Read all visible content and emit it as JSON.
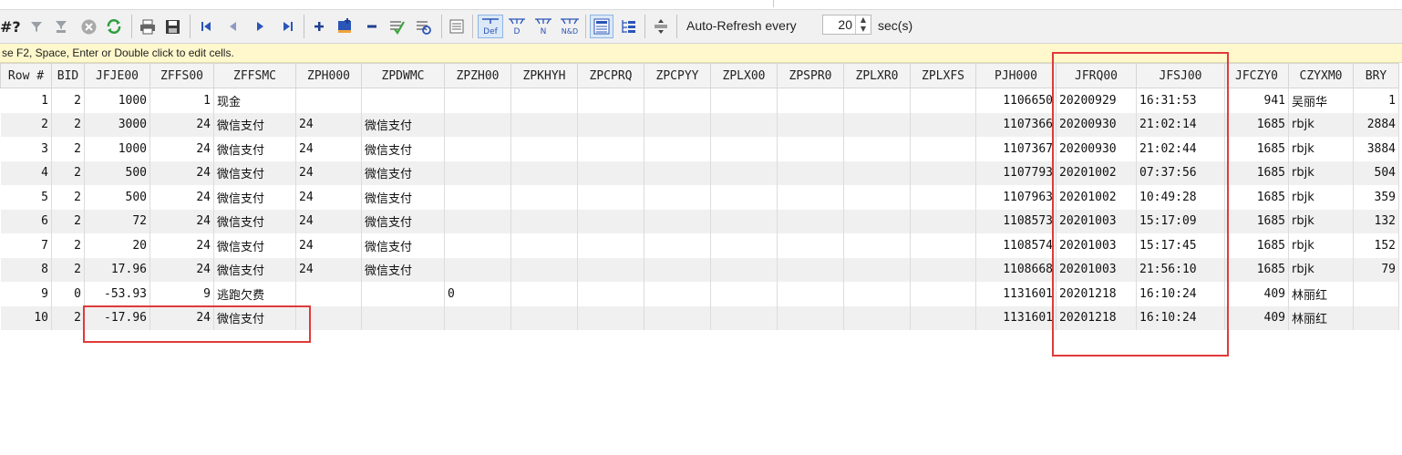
{
  "toolbar": {
    "hash_label": "#?",
    "autorefresh_label": "Auto-Refresh every",
    "interval_value": "20",
    "interval_unit": "sec(s)",
    "def_label": "Def",
    "d_label": "D",
    "n_label": "N",
    "nd_label": "N&D"
  },
  "hint_text": "se F2, Space, Enter or Double click to edit cells.",
  "grid": {
    "columns": [
      "Row #",
      "BID",
      "JFJE00",
      "ZFFS00",
      "ZFFSMC",
      "ZPH000",
      "ZPDWMC",
      "ZPZH00",
      "ZPKHYH",
      "ZPCPRQ",
      "ZPCPYY",
      "ZPLX00",
      "ZPSPR0",
      "ZPLXR0",
      "ZPLXFS",
      "PJH000",
      "JFRQ00",
      "JFSJ00",
      "JFCZY0",
      "CZYXM0",
      "BRY"
    ],
    "rows": [
      [
        "1",
        "2",
        "1000",
        "1",
        "现金",
        "",
        "",
        "",
        "",
        "",
        "",
        "",
        "",
        "",
        "",
        "1106650",
        "20200929",
        "16:31:53",
        "941",
        "吴丽华",
        "1"
      ],
      [
        "2",
        "2",
        "3000",
        "24",
        "微信支付",
        "24",
        "微信支付",
        "",
        "",
        "",
        "",
        "",
        "",
        "",
        "",
        "1107366",
        "20200930",
        "21:02:14",
        "1685",
        "rbjk",
        "2884"
      ],
      [
        "3",
        "2",
        "1000",
        "24",
        "微信支付",
        "24",
        "微信支付",
        "",
        "",
        "",
        "",
        "",
        "",
        "",
        "",
        "1107367",
        "20200930",
        "21:02:44",
        "1685",
        "rbjk",
        "3884"
      ],
      [
        "4",
        "2",
        "500",
        "24",
        "微信支付",
        "24",
        "微信支付",
        "",
        "",
        "",
        "",
        "",
        "",
        "",
        "",
        "1107793",
        "20201002",
        "07:37:56",
        "1685",
        "rbjk",
        "504"
      ],
      [
        "5",
        "2",
        "500",
        "24",
        "微信支付",
        "24",
        "微信支付",
        "",
        "",
        "",
        "",
        "",
        "",
        "",
        "",
        "1107963",
        "20201002",
        "10:49:28",
        "1685",
        "rbjk",
        "359"
      ],
      [
        "6",
        "2",
        "72",
        "24",
        "微信支付",
        "24",
        "微信支付",
        "",
        "",
        "",
        "",
        "",
        "",
        "",
        "",
        "1108573",
        "20201003",
        "15:17:09",
        "1685",
        "rbjk",
        "132"
      ],
      [
        "7",
        "2",
        "20",
        "24",
        "微信支付",
        "24",
        "微信支付",
        "",
        "",
        "",
        "",
        "",
        "",
        "",
        "",
        "1108574",
        "20201003",
        "15:17:45",
        "1685",
        "rbjk",
        "152"
      ],
      [
        "8",
        "2",
        "17.96",
        "24",
        "微信支付",
        "24",
        "微信支付",
        "",
        "",
        "",
        "",
        "",
        "",
        "",
        "",
        "1108668",
        "20201003",
        "21:56:10",
        "1685",
        "rbjk",
        "79"
      ],
      [
        "9",
        "0",
        "-53.93",
        "9",
        "逃跑欠费",
        "",
        "",
        "0",
        "",
        "",
        "",
        "",
        "",
        "",
        "",
        "1131601",
        "20201218",
        "16:10:24",
        "409",
        "林丽红",
        ""
      ],
      [
        "10",
        "2",
        "-17.96",
        "24",
        "微信支付",
        "",
        "",
        "",
        "",
        "",
        "",
        "",
        "",
        "",
        "",
        "1131601",
        "20201218",
        "16:10:24",
        "409",
        "林丽红",
        ""
      ]
    ]
  }
}
